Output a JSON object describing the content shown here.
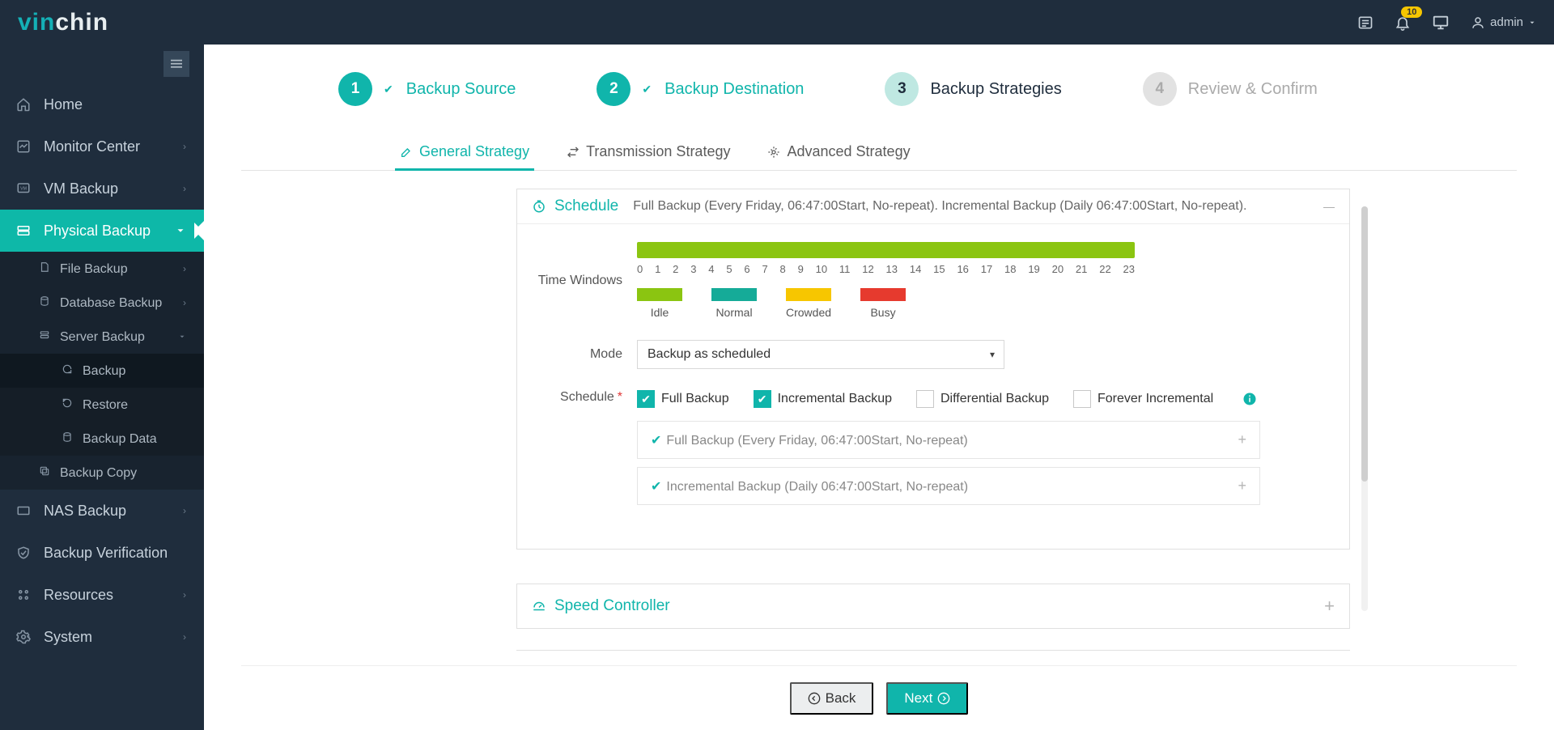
{
  "brand": {
    "pre": "vin",
    "post": "chin"
  },
  "header": {
    "notif_count": "10",
    "user": "admin"
  },
  "sidebar": {
    "home": "Home",
    "monitor": "Monitor Center",
    "vm": "VM Backup",
    "physical": "Physical Backup",
    "file": "File Backup",
    "db": "Database Backup",
    "server": "Server Backup",
    "backup": "Backup",
    "restore": "Restore",
    "backup_data": "Backup Data",
    "backup_copy": "Backup Copy",
    "nas": "NAS Backup",
    "verify": "Backup Verification",
    "resources": "Resources",
    "system": "System"
  },
  "wizard": {
    "s1": "Backup Source",
    "s2": "Backup Destination",
    "s3": "Backup Strategies",
    "s4": "Review & Confirm"
  },
  "tabs": {
    "general": "General Strategy",
    "transmission": "Transmission Strategy",
    "advanced": "Advanced Strategy"
  },
  "schedule": {
    "title": "Schedule",
    "desc": "Full Backup (Every Friday, 06:47:00Start, No-repeat). Incremental Backup (Daily 06:47:00Start, No-repeat).",
    "time_windows_label": "Time Windows",
    "ticks": [
      "0",
      "1",
      "2",
      "3",
      "4",
      "5",
      "6",
      "7",
      "8",
      "9",
      "10",
      "11",
      "12",
      "13",
      "14",
      "15",
      "16",
      "17",
      "18",
      "19",
      "20",
      "21",
      "22",
      "23"
    ],
    "legend": {
      "idle": "Idle",
      "normal": "Normal",
      "crowded": "Crowded",
      "busy": "Busy"
    },
    "mode_label": "Mode",
    "mode_value": "Backup as scheduled",
    "schedule_label": "Schedule",
    "cb_full": "Full Backup",
    "cb_incr": "Incremental Backup",
    "cb_diff": "Differential Backup",
    "cb_forever": "Forever Incremental",
    "row_full": "Full Backup (Every Friday, 06:47:00Start, No-repeat)",
    "row_incr": "Incremental Backup (Daily 06:47:00Start, No-repeat)"
  },
  "speed": {
    "title": "Speed Controller"
  },
  "footer": {
    "back": "Back",
    "next": "Next"
  }
}
